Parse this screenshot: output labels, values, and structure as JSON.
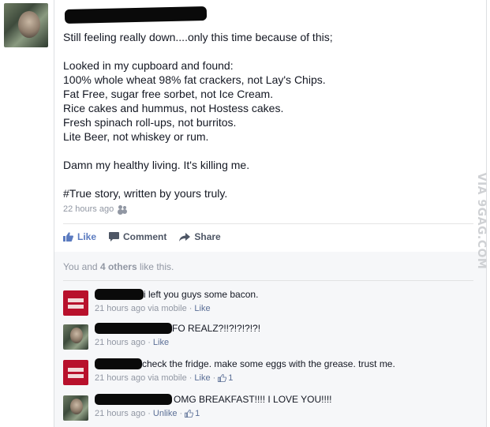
{
  "post": {
    "lines": [
      "Still feeling really down....only this time because of this;",
      "",
      "Looked in my cupboard and found:",
      "100% whole wheat 98% fat crackers, not Lay's Chips.",
      "Fat Free, sugar free sorbet, not Ice Cream.",
      "Rice cakes and hummus, not Hostess cakes.",
      "Fresh spinach roll-ups, not burritos.",
      "Lite Beer, not whiskey or rum.",
      "",
      "Damn my healthy living. It's killing me.",
      "",
      "#True story, written by yours truly."
    ],
    "timestamp": "22 hours ago",
    "audience_icon": "friends-icon"
  },
  "actions": {
    "like": "Like",
    "comment": "Comment",
    "share": "Share"
  },
  "likes": {
    "prefix": "You and ",
    "count": "4 others",
    "suffix": " like this."
  },
  "comments": [
    {
      "avatar": "hrc-equality-logo",
      "text": "i left you guys some bacon.",
      "time": "21 hours ago",
      "via": "via mobile",
      "like_label": "Like",
      "likes": ""
    },
    {
      "avatar": "profile-photo",
      "text": "FO REALZ?!!?!?!?!?!",
      "time": "21 hours ago",
      "via": "",
      "like_label": "Like",
      "likes": ""
    },
    {
      "avatar": "hrc-equality-logo",
      "text": "check the fridge. make some eggs with the grease. trust me.",
      "time": "21 hours ago",
      "via": "via mobile",
      "like_label": "Like",
      "likes": "1"
    },
    {
      "avatar": "profile-photo",
      "text": "OMG BREAKFAST!!!! I LOVE YOU!!!!",
      "time": "21 hours ago",
      "via": "",
      "like_label": "Unlike",
      "likes": "1"
    }
  ],
  "watermark": "VIA 9GAG.COM",
  "colors": {
    "link_blue": "#5b7bc0",
    "meta_gray": "#9197a3",
    "hrc_red": "#b8112c"
  }
}
